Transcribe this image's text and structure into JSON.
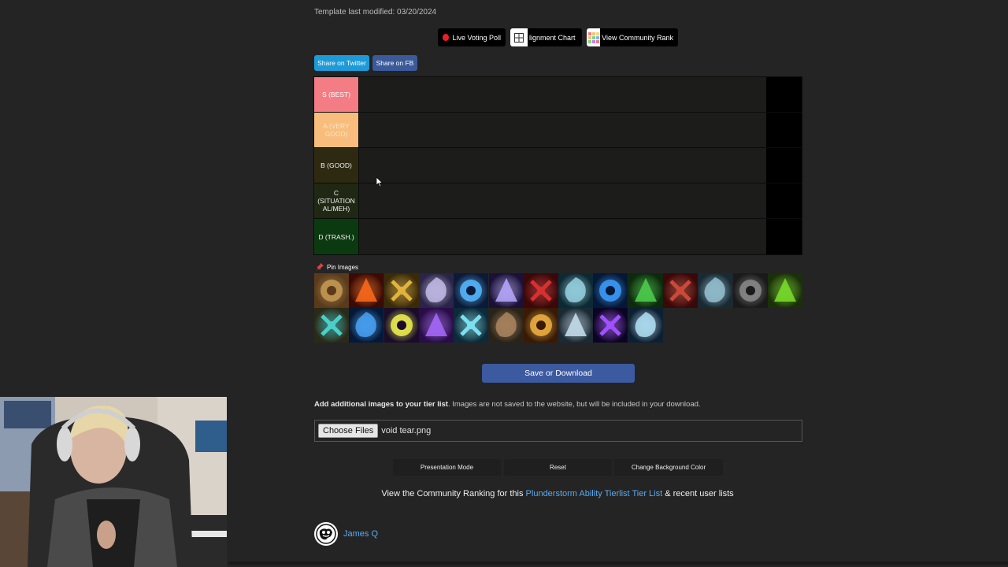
{
  "template_modified": "Template last modified: 03/20/2024",
  "top_buttons": {
    "poll": "Live Voting Poll",
    "alignment": "Alignment Chart",
    "alignment_visible": "lignment Chart",
    "community_rank": "View Community Rank"
  },
  "share": {
    "twitter": "Share on Twitter",
    "facebook": "Share on FB"
  },
  "tiers": [
    {
      "label": "S (BEST)",
      "color": "#f47c84",
      "text_color": "#ffffff"
    },
    {
      "label": "A (VERY GOOD)",
      "color": "#f8bd7c",
      "text_color": "#fde3c4"
    },
    {
      "label": "B (GOOD)",
      "color": "#2e2a12",
      "text_color": "#f2f2f2"
    },
    {
      "label": "C (SITUATION AL/MEH)",
      "color": "#1f2812",
      "text_color": "#f2f2f2"
    },
    {
      "label": "D (TRASH.)",
      "color": "#0c3a10",
      "text_color": "#f2f2f2"
    }
  ],
  "pin_images": "Pin Images",
  "ability_icons": [
    "spiked-bone-icon",
    "fire-blast-icon",
    "golden-shield-icon",
    "crystal-blade-icon",
    "arcane-lightning-icon",
    "void-orb-icon",
    "blood-claw-icon",
    "frost-wing-icon",
    "vortex-icon",
    "green-skull-icon",
    "crimson-beast-icon",
    "wind-tornado-icon",
    "dark-gear-icon",
    "fel-cross-icon",
    "teal-relic-icon",
    "frost-nova-icon",
    "lightning-strike-icon",
    "violet-shield-icon",
    "ice-shard-icon",
    "stone-hand-icon",
    "golden-warrior-icon",
    "bone-dragon-icon",
    "violet-beam-icon",
    "crescent-moon-icon"
  ],
  "save_button": "Save or Download",
  "add_images": {
    "bold": "Add additional images to your tier list",
    "rest": ". Images are not saved to the website, but will be included in your download."
  },
  "file_input": {
    "button": "Choose Files",
    "filename": "void tear.png"
  },
  "options": {
    "presentation": "Presentation Mode",
    "reset": "Reset",
    "background": "Change Background Color"
  },
  "community": {
    "prefix": "View the Community Ranking for this ",
    "link": "Plunderstorm Ability Tierlist Tier List",
    "suffix": " & recent user lists"
  },
  "user": {
    "name": "James Q"
  }
}
